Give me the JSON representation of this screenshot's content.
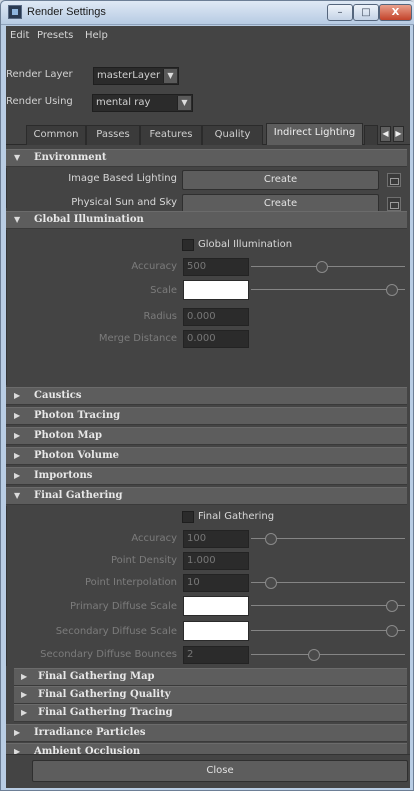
{
  "window": {
    "title": "Render Settings",
    "minimize": "–",
    "maximize": "□",
    "close": "X"
  },
  "menu": [
    "Edit",
    "Presets",
    "Help"
  ],
  "render_layer": {
    "label": "Render Layer",
    "value": "masterLayer"
  },
  "render_using": {
    "label": "Render Using",
    "value": "mental ray"
  },
  "tabs": [
    "Common",
    "Passes",
    "Features",
    "Quality",
    "Indirect Lighting"
  ],
  "active_tab": "Indirect Lighting",
  "sections": {
    "environment": {
      "title": "Environment",
      "ibl_label": "Image Based Lighting",
      "ibl_button": "Create",
      "sun_label": "Physical Sun and Sky",
      "sun_button": "Create"
    },
    "gi": {
      "title": "Global Illumination",
      "checkbox": "Global Illumination",
      "accuracy_label": "Accuracy",
      "accuracy_value": "500",
      "accuracy_slider": 0.46,
      "scale_label": "Scale",
      "scale_slider": 0.95,
      "radius_label": "Radius",
      "radius_value": "0.000",
      "merge_label": "Merge Distance",
      "merge_value": "0.000"
    },
    "collapsed": [
      "Caustics",
      "Photon Tracing",
      "Photon Map",
      "Photon Volume",
      "Importons"
    ],
    "fg": {
      "title": "Final Gathering",
      "checkbox": "Final Gathering",
      "accuracy_label": "Accuracy",
      "accuracy_value": "100",
      "accuracy_slider": 0.1,
      "density_label": "Point Density",
      "density_value": "1.000",
      "interp_label": "Point Interpolation",
      "interp_value": "10",
      "interp_slider": 0.1,
      "primary_label": "Primary Diffuse Scale",
      "primary_slider": 0.95,
      "secondary_label": "Secondary Diffuse Scale",
      "secondary_slider": 0.95,
      "bounces_label": "Secondary Diffuse Bounces",
      "bounces_value": "2",
      "bounces_slider": 0.4
    },
    "fg_sub": [
      "Final Gathering Map",
      "Final Gathering Quality",
      "Final Gathering Tracing"
    ],
    "tail": [
      "Irradiance Particles",
      "Ambient Occlusion"
    ]
  },
  "footer": {
    "close": "Close"
  }
}
